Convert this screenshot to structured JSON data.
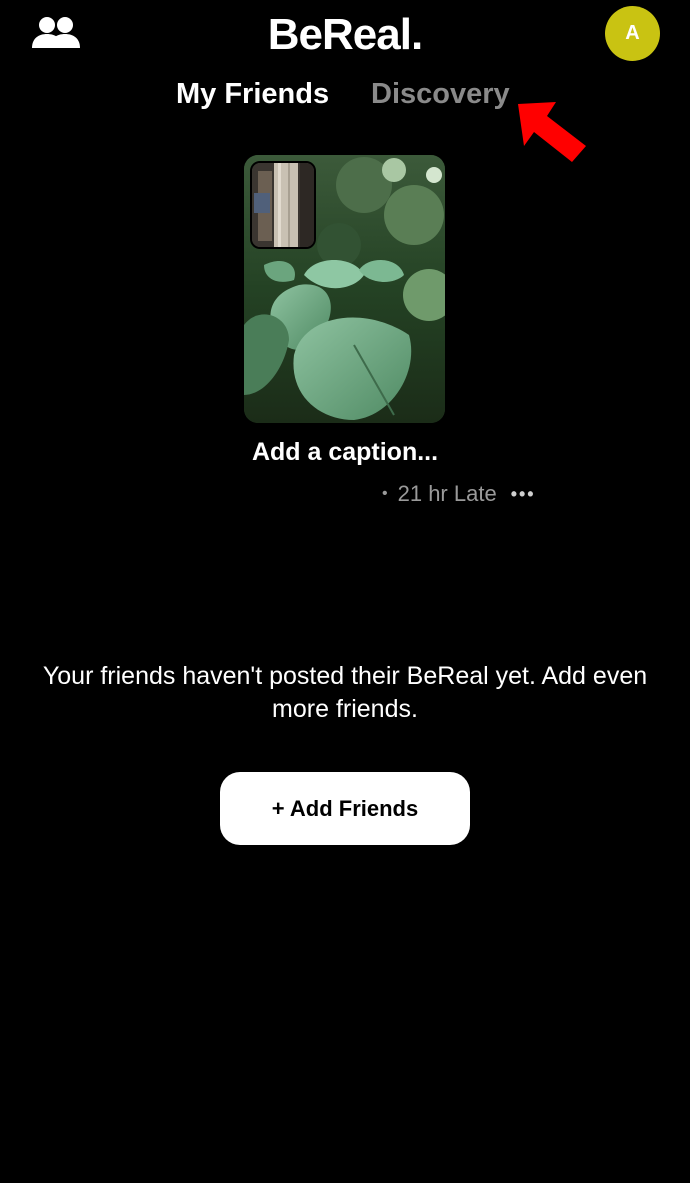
{
  "header": {
    "app_title": "BeReal.",
    "avatar_initial": "A",
    "friends_icon": "people-icon",
    "avatar_color": "#c9c312"
  },
  "tabs": [
    {
      "label": "My Friends",
      "active": true
    },
    {
      "label": "Discovery",
      "active": false
    }
  ],
  "annotation": {
    "icon": "red-arrow-icon",
    "color": "#ff0000"
  },
  "post": {
    "caption": "Add a caption...",
    "time_status": "21 hr Late",
    "separator": "•",
    "more_icon": "•••"
  },
  "empty_state": {
    "message": "Your friends haven't posted their BeReal yet. Add even more friends.",
    "button_label": "+ Add Friends"
  }
}
